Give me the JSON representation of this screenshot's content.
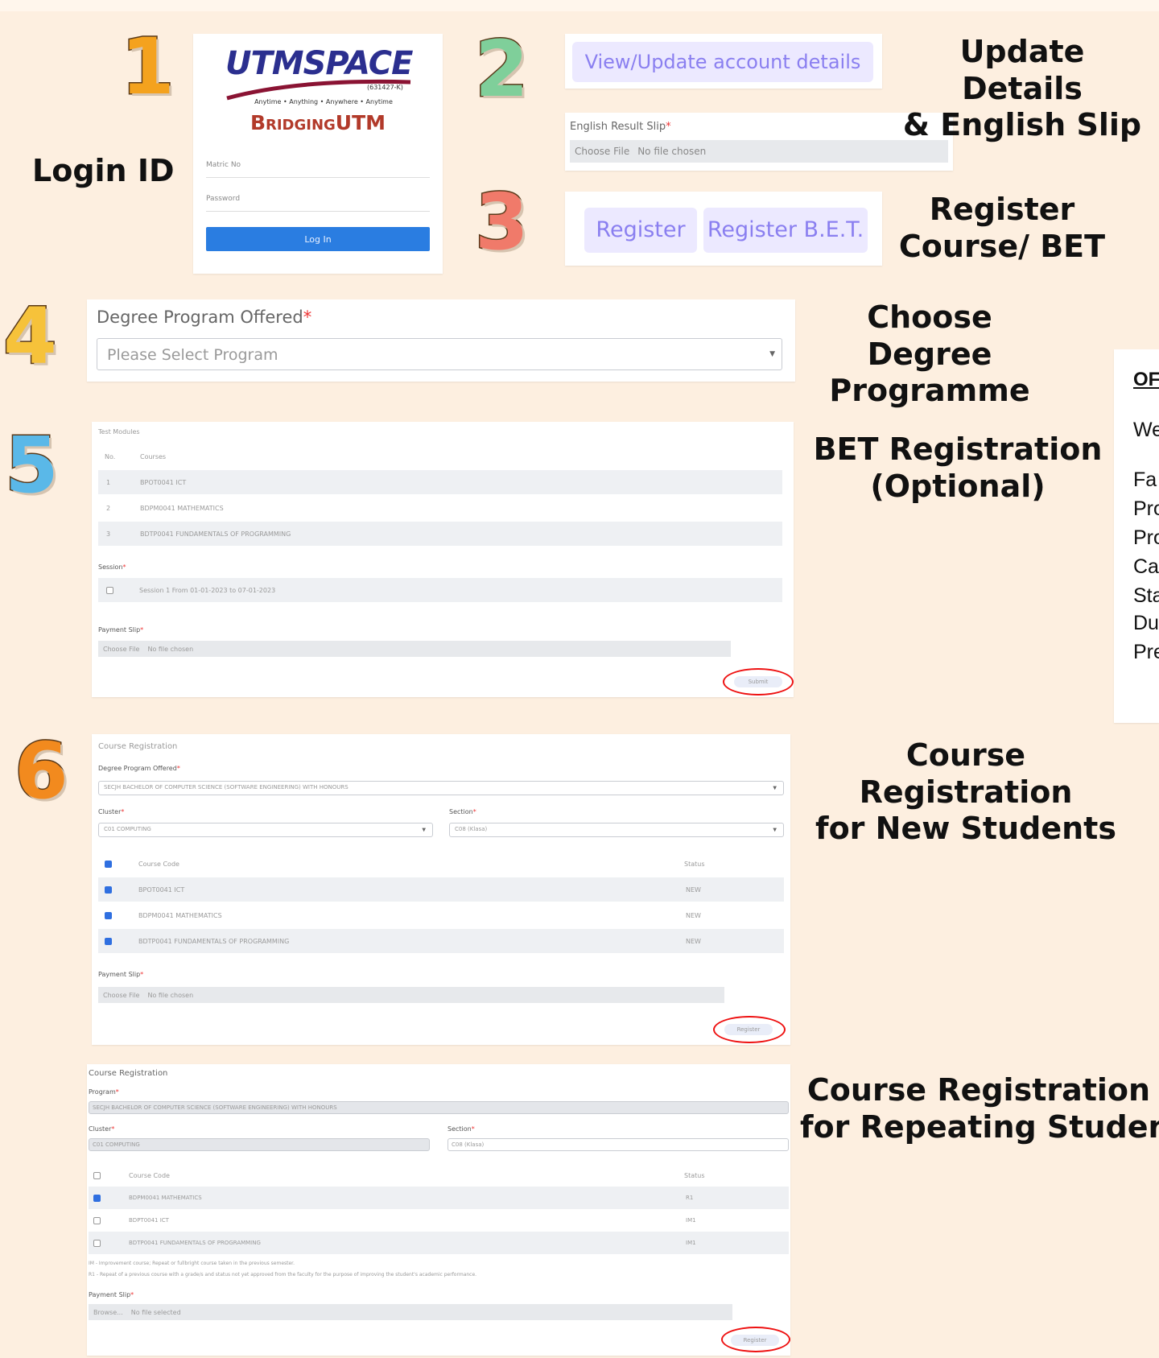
{
  "steps": [
    {
      "num": "1",
      "color": "#f4a21e",
      "label": "Login ID"
    },
    {
      "num": "2",
      "color": "#7fcf9a",
      "label_lines": [
        "Update Details",
        "& English Slip"
      ]
    },
    {
      "num": "3",
      "color": "#f07a6a",
      "label_lines": [
        "Register",
        "Course/ BET"
      ]
    },
    {
      "num": "4",
      "color": "#f6c23a",
      "label_lines": [
        "Choose Degree",
        "Programme"
      ]
    },
    {
      "num": "5",
      "color": "#5ab8e8",
      "label_lines": [
        "BET Registration",
        "(Optional)"
      ]
    },
    {
      "num": "6",
      "color": "#f28a1e",
      "label_lines": [
        "Course Registration",
        "for New Students"
      ]
    },
    {
      "num": "",
      "color": "",
      "label_lines": [
        "Course Registration",
        "for Repeating Students"
      ]
    }
  ],
  "login": {
    "brand": "UTMSPACE",
    "brand_sub": "(631427-K)",
    "tagline": "Anytime • Anything • Anywhere • Anytime",
    "app_name": "BridgingUTM",
    "matric_label": "Matric No",
    "password_label": "Password",
    "button": "Log In"
  },
  "update": {
    "button": "View/Update account details",
    "english_slip_label": "English Result Slip",
    "choose_file": "Choose File",
    "no_file": "No file chosen"
  },
  "register": {
    "register_button": "Register",
    "register_bet_button": "Register B.E.T."
  },
  "degree": {
    "label": "Degree Program Offered",
    "placeholder": "Please Select Program"
  },
  "bet": {
    "heading": "Test Modules",
    "col_no": "No.",
    "col_course": "Courses",
    "rows": [
      {
        "no": "1",
        "course": "BPOT0041 ICT"
      },
      {
        "no": "2",
        "course": "BDPM0041 MATHEMATICS"
      },
      {
        "no": "3",
        "course": "BDTP0041 FUNDAMENTALS OF PROGRAMMING"
      }
    ],
    "session_label": "Session",
    "session_value": "Session 1 From 01-01-2023 to 07-01-2023",
    "payment_label": "Payment Slip",
    "choose_file": "Choose File",
    "no_file": "No file chosen",
    "submit": "Submit"
  },
  "new_students": {
    "heading": "Course Registration",
    "program_label": "Degree Program Offered",
    "program_value": "SECJH BACHELOR OF COMPUTER SCIENCE (SOFTWARE ENGINEERING) WITH HONOURS",
    "cluster_label": "Cluster",
    "cluster_value": "C01 COMPUTING",
    "section_label": "Section",
    "section_value": "C08 (Klasa)",
    "col_code": "Course Code",
    "col_status": "Status",
    "rows": [
      {
        "code": "BPOT0041 ICT",
        "status": "NEW"
      },
      {
        "code": "BDPM0041 MATHEMATICS",
        "status": "NEW"
      },
      {
        "code": "BDTP0041 FUNDAMENTALS OF PROGRAMMING",
        "status": "NEW"
      }
    ],
    "payment_label": "Payment Slip",
    "choose_file": "Choose File",
    "no_file": "No file chosen",
    "submit": "Register"
  },
  "repeating": {
    "heading": "Course Registration",
    "program_label": "Program",
    "program_value": "SECJH BACHELOR OF COMPUTER SCIENCE (SOFTWARE ENGINEERING) WITH HONOURS",
    "cluster_label": "Cluster",
    "cluster_value": "C01 COMPUTING",
    "section_label": "Section",
    "section_value": "C08 (Klasa)",
    "col_code": "Course Code",
    "col_status": "Status",
    "rows": [
      {
        "code": "BDPM0041 MATHEMATICS",
        "status": "R1",
        "checked": true
      },
      {
        "code": "BDPT0041 ICT",
        "status": "IM1",
        "checked": false
      },
      {
        "code": "BDTP0041 FUNDAMENTALS OF PROGRAMMING",
        "status": "IM1",
        "checked": false
      }
    ],
    "note1": "IM - Improvement course; Repeat or fullbright course taken in the previous semester.",
    "note2": "R1 - Repeat of a previous course with a grade/s and status not yet approved from the faculty for the purpose of improving the student's academic performance.",
    "payment_label": "Payment Slip",
    "choose_file": "Browse...",
    "no_file": "No file selected",
    "submit": "Register"
  },
  "side_panel": {
    "title": "OF",
    "lines": [
      "We",
      "Fa",
      "Pro",
      "Pro",
      "Ca",
      "Sta",
      "Du",
      "Pre"
    ]
  }
}
